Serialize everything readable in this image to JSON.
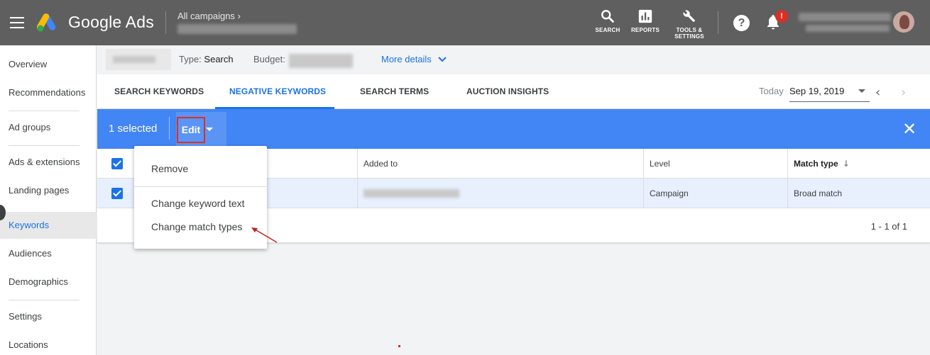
{
  "header": {
    "app_name": "Google Ads",
    "breadcrumb_top": "All campaigns",
    "tools": [
      {
        "label": "SEARCH",
        "icon": "search-icon"
      },
      {
        "label": "REPORTS",
        "icon": "reports-icon"
      },
      {
        "label": "TOOLS &",
        "label2": "SETTINGS",
        "icon": "wrench-icon"
      }
    ],
    "help_glyph": "?",
    "notification_badge": "!"
  },
  "leftnav": {
    "items": [
      {
        "label": "Overview"
      },
      {
        "label": "Recommendations"
      },
      {
        "label": "Ad groups"
      },
      {
        "label": "Ads & extensions"
      },
      {
        "label": "Landing pages"
      },
      {
        "label": "Keywords",
        "active": true
      },
      {
        "label": "Audiences"
      },
      {
        "label": "Demographics"
      },
      {
        "label": "Settings"
      },
      {
        "label": "Locations"
      }
    ]
  },
  "infobar": {
    "type_label": "Type:",
    "type_value": "Search",
    "budget_label": "Budget:",
    "more_details": "More details"
  },
  "tabs": {
    "items": [
      {
        "label": "SEARCH KEYWORDS"
      },
      {
        "label": "NEGATIVE KEYWORDS",
        "active": true
      },
      {
        "label": "SEARCH TERMS"
      },
      {
        "label": "AUCTION INSIGHTS"
      }
    ],
    "date_label": "Today",
    "date_value": "Sep 19, 2019"
  },
  "selection_bar": {
    "count_text": "1 selected",
    "edit_label": "Edit",
    "close_glyph": "✕"
  },
  "table": {
    "headers": {
      "added_to": "Added to",
      "level": "Level",
      "match_type": "Match type"
    },
    "rows": [
      {
        "level": "Campaign",
        "match_type": "Broad match"
      }
    ],
    "pagination": "1 - 1 of 1"
  },
  "edit_menu": {
    "items": [
      {
        "label": "Remove"
      },
      {
        "label": "Change keyword text"
      },
      {
        "label": "Change match types"
      }
    ]
  },
  "colors": {
    "topbar": "#5f5f5f",
    "selection_bar": "#4285f4",
    "accent": "#1a73e8",
    "highlight_border": "#d93025"
  }
}
